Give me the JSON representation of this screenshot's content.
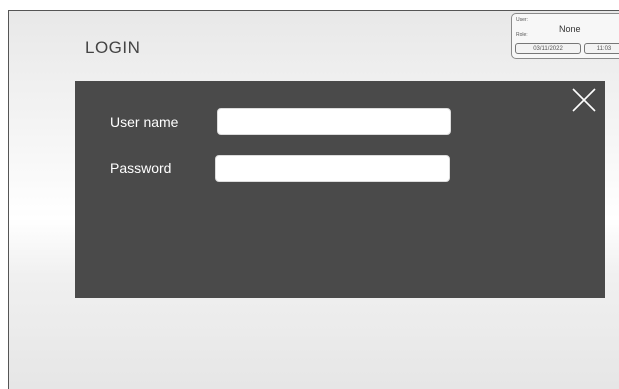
{
  "page": {
    "title": "LOGIN"
  },
  "info_panel": {
    "user_label": "User:",
    "role_label": "Role:",
    "user_value": "None",
    "date": "03/11/2022",
    "time": "11:03"
  },
  "dialog": {
    "username_label": "User name",
    "username_value": "",
    "password_label": "Password",
    "password_value": "",
    "close_icon": "close-icon"
  },
  "colors": {
    "dialog_background": "#4a4a4a",
    "label_text": "#ffffff",
    "input_background": "#ffffff"
  }
}
